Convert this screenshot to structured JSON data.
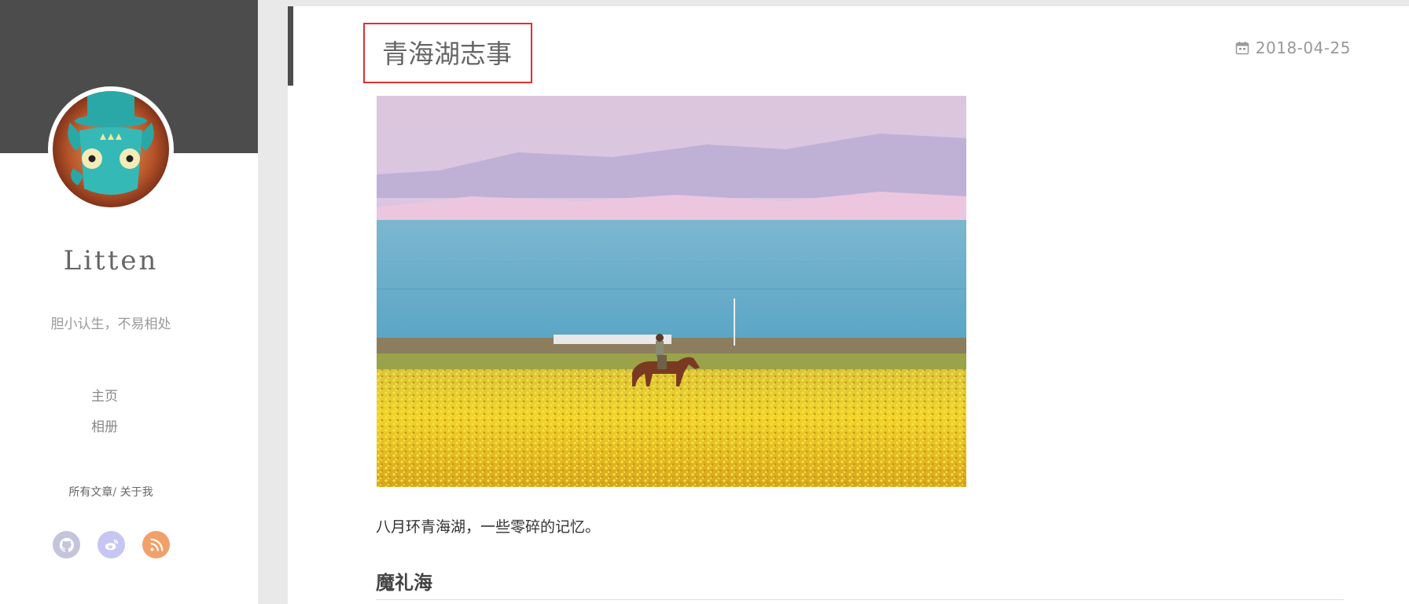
{
  "sidebar": {
    "site_name": "Litten",
    "description": "胆小认生，不易相处",
    "nav": [
      {
        "label": "主页"
      },
      {
        "label": "相册"
      }
    ],
    "links": {
      "all_posts": "所有文章",
      "separator": "/",
      "about": "关于我"
    },
    "social": [
      {
        "icon": "github-icon",
        "color": "#c3c6db"
      },
      {
        "icon": "weibo-icon",
        "color": "#c6c6f2"
      },
      {
        "icon": "rss-icon",
        "color": "#f2a06a"
      }
    ],
    "header_color": "#4c4c4c"
  },
  "post": {
    "title": "青海湖志事",
    "date": "2018-04-25",
    "date_icon": "calendar-icon",
    "image_alt": "",
    "intro": "八月环青海湖，一些零碎的记忆。",
    "section_heading": "魔礼海"
  },
  "colors": {
    "title_highlight_border": "#e03030",
    "accent_bar": "#4c4c4c"
  }
}
